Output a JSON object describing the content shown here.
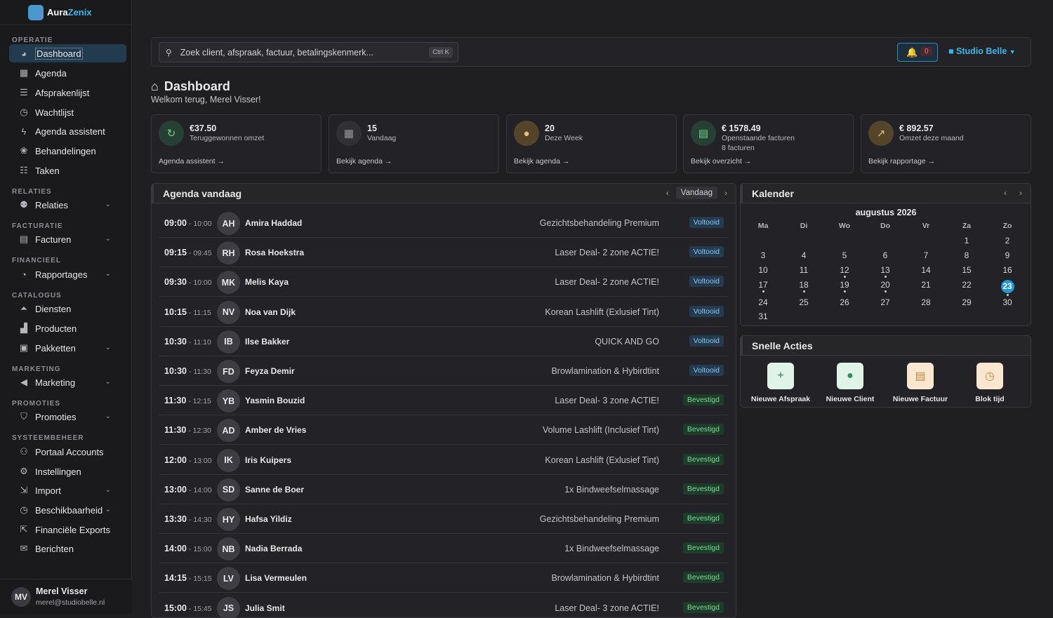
{
  "app": {
    "name_a": "Aura",
    "name_b": "Zenix"
  },
  "sidebar": {
    "sections": [
      "OPERATIE",
      "RELATIES",
      "FACTURATIE",
      "FINANCIEEL",
      "CATALOGUS",
      "MARKETING",
      "PROMOTIES",
      "SYSTEEMBEHEER"
    ],
    "items": [
      {
        "label": "Dashboard",
        "icon": "dashboard-icon"
      },
      {
        "label": "Agenda",
        "icon": "calendar-icon"
      },
      {
        "label": "Afsprakenlijst",
        "icon": "list-icon"
      },
      {
        "label": "Wachtlijst",
        "icon": "clock-icon"
      },
      {
        "label": "Agenda assistent",
        "icon": "bolt-icon"
      },
      {
        "label": "Behandelingen",
        "icon": "spa-icon"
      },
      {
        "label": "Taken",
        "icon": "tasks-icon"
      },
      {
        "label": "Relaties",
        "icon": "users-icon"
      },
      {
        "label": "Facturen",
        "icon": "invoice-icon"
      },
      {
        "label": "Rapportages",
        "icon": "pie-chart-icon"
      },
      {
        "label": "Diensten",
        "icon": "service-icon"
      },
      {
        "label": "Producten",
        "icon": "boxes-icon"
      },
      {
        "label": "Pakketten",
        "icon": "package-icon"
      },
      {
        "label": "Marketing",
        "icon": "megaphone-icon"
      },
      {
        "label": "Promoties",
        "icon": "tags-icon"
      },
      {
        "label": "Portaal Accounts",
        "icon": "user-cog-icon"
      },
      {
        "label": "Instellingen",
        "icon": "gear-icon"
      },
      {
        "label": "Import",
        "icon": "import-icon"
      },
      {
        "label": "Beschikbaarheid",
        "icon": "clock-icon"
      },
      {
        "label": "Financiële Exports",
        "icon": "file-export-icon"
      },
      {
        "label": "Berichten",
        "icon": "mail-icon"
      }
    ],
    "user": {
      "initials": "MV",
      "name": "Merel Visser",
      "email": "merel@studiobelle.nl"
    }
  },
  "topbar": {
    "search_placeholder": "Zoek client, afspraak, factuur, betalingskenmerk...",
    "shortcut": "Ctrl K",
    "notification_count": "0",
    "studio": "Studio Belle"
  },
  "page": {
    "title": "Dashboard",
    "welcome": "Welkom terug, Merel Visser!"
  },
  "stats": [
    {
      "value": "€37.50",
      "label": "Teruggewonnen omzet",
      "sub": "",
      "link": "Agenda assistent →",
      "color": "#2e7d4f",
      "icon": "refresh-icon"
    },
    {
      "value": "15",
      "label": "Vandaag",
      "sub": "",
      "link": "Bekijk agenda →",
      "color": "#4a4a50",
      "icon": "calendar-icon"
    },
    {
      "value": "20",
      "label": "Deze Week",
      "sub": "",
      "link": "Bekijk agenda →",
      "color": "#b7872f",
      "icon": "user-icon"
    },
    {
      "value": "€ 1578.49",
      "label": "Openstaande facturen",
      "sub": "8 facturen",
      "link": "Bekijk overzicht →",
      "color": "#2e7d4f",
      "icon": "invoice-icon"
    },
    {
      "value": "€ 892.57",
      "label": "Omzet deze maand",
      "sub": "",
      "link": "Bekijk rapportage →",
      "color": "#b7872f",
      "icon": "chart-line-icon"
    }
  ],
  "agenda": {
    "title": "Agenda vandaag",
    "today_label": "Vandaag",
    "rows": [
      {
        "start": "09:00",
        "end": "10:00",
        "initials": "AH",
        "name": "Amira Haddad",
        "service": "Gezichtsbehandeling Premium",
        "status": "Voltooid"
      },
      {
        "start": "09:15",
        "end": "09:45",
        "initials": "RH",
        "name": "Rosa Hoekstra",
        "service": "Laser Deal- 2 zone ACTIE!",
        "status": "Voltooid"
      },
      {
        "start": "09:30",
        "end": "10:00",
        "initials": "MK",
        "name": "Melis Kaya",
        "service": "Laser Deal- 2 zone ACTIE!",
        "status": "Voltooid"
      },
      {
        "start": "10:15",
        "end": "11:15",
        "initials": "NV",
        "name": "Noa van Dijk",
        "service": "Korean Lashlift (Exlusief Tint)",
        "status": "Voltooid"
      },
      {
        "start": "10:30",
        "end": "11:10",
        "initials": "IB",
        "name": "Ilse Bakker",
        "service": "QUICK AND GO",
        "status": "Voltooid"
      },
      {
        "start": "10:30",
        "end": "11:30",
        "initials": "FD",
        "name": "Feyza Demir",
        "service": "Browlamination & Hybirdtint",
        "status": "Voltooid"
      },
      {
        "start": "11:30",
        "end": "12:15",
        "initials": "YB",
        "name": "Yasmin Bouzid",
        "service": "Laser Deal- 3 zone ACTIE!",
        "status": "Bevestigd"
      },
      {
        "start": "11:30",
        "end": "12:30",
        "initials": "AD",
        "name": "Amber de Vries",
        "service": "Volume Lashlift (Inclusief Tint)",
        "status": "Bevestigd"
      },
      {
        "start": "12:00",
        "end": "13:00",
        "initials": "IK",
        "name": "Iris Kuipers",
        "service": "Korean Lashlift (Exlusief Tint)",
        "status": "Bevestigd"
      },
      {
        "start": "13:00",
        "end": "14:00",
        "initials": "SD",
        "name": "Sanne de Boer",
        "service": "1x Bindweefselmassage",
        "status": "Bevestigd"
      },
      {
        "start": "13:30",
        "end": "14:30",
        "initials": "HY",
        "name": "Hafsa Yildiz",
        "service": "Gezichtsbehandeling Premium",
        "status": "Bevestigd"
      },
      {
        "start": "14:00",
        "end": "15:00",
        "initials": "NB",
        "name": "Nadia Berrada",
        "service": "1x Bindweefselmassage",
        "status": "Bevestigd"
      },
      {
        "start": "14:15",
        "end": "15:15",
        "initials": "LV",
        "name": "Lisa Vermeulen",
        "service": "Browlamination & Hybirdtint",
        "status": "Bevestigd"
      },
      {
        "start": "15:00",
        "end": "15:45",
        "initials": "JS",
        "name": "Julia Smit",
        "service": "Laser Deal- 3 zone ACTIE!",
        "status": "Bevestigd"
      }
    ]
  },
  "calendar": {
    "title": "Kalender",
    "month": "augustus 2026",
    "dow": [
      "Ma",
      "Di",
      "Wo",
      "Do",
      "Vr",
      "Za",
      "Zo"
    ],
    "first_weekday": 5,
    "days_in_month": 31,
    "selected": 23,
    "dots": [
      12,
      13,
      17,
      18,
      19,
      20,
      23
    ]
  },
  "quick_actions": {
    "title": "Snelle Acties",
    "items": [
      {
        "label": "Nieuwe Afspraak",
        "icon": "plus-icon",
        "bg": "#dff3e6",
        "fg": "#2e7d4f"
      },
      {
        "label": "Nieuwe Client",
        "icon": "user-icon",
        "bg": "#dff3e6",
        "fg": "#2e8f5a"
      },
      {
        "label": "Nieuwe Factuur",
        "icon": "invoice-icon",
        "bg": "#fbe6cf",
        "fg": "#c98a3a"
      },
      {
        "label": "Blok tijd",
        "icon": "clock-icon",
        "bg": "#fbe6cf",
        "fg": "#c98a3a"
      }
    ]
  }
}
